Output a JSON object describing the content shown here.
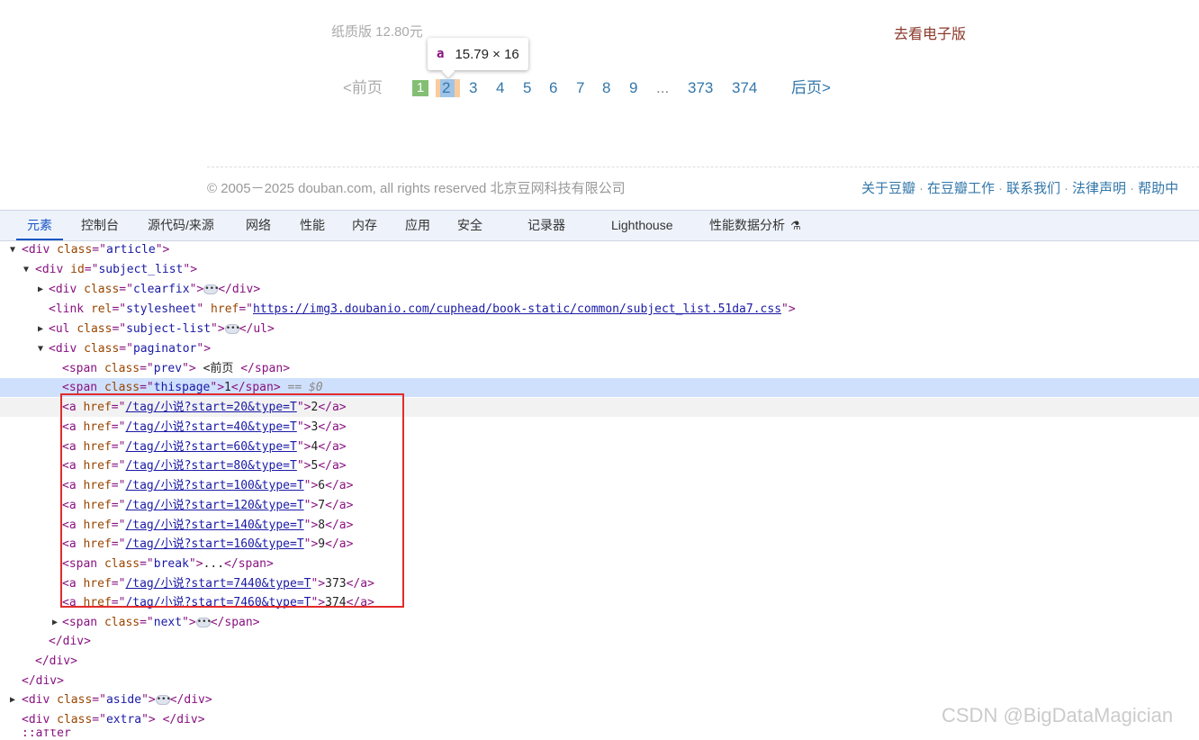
{
  "webpage": {
    "paper_price": "纸质版 12.80元",
    "ebook_link": "去看电子版",
    "tooltip": {
      "tag": "a",
      "size": "15.79 × 16"
    },
    "pager": {
      "prev": "<前页",
      "current": "1",
      "pages": [
        "2",
        "3",
        "4",
        "5",
        "6",
        "7",
        "8",
        "9"
      ],
      "break": "...",
      "last_pages": [
        "373",
        "374"
      ],
      "next": "后页>"
    },
    "footer": {
      "copyright": "© 2005－2025 douban.com, all rights reserved 北京豆网科技有限公司",
      "links": [
        "关于豆瓣",
        "在豆瓣工作",
        "联系我们",
        "法律声明",
        "帮助中"
      ]
    }
  },
  "devtools": {
    "tabs": [
      "元素",
      "控制台",
      "源代码/来源",
      "网络",
      "性能",
      "内存",
      "应用",
      "安全",
      "记录器",
      "Lighthouse",
      "性能数据分析"
    ],
    "active_tab": "元素",
    "nodes": {
      "article": {
        "tag": "div",
        "attr": "class",
        "val": "article"
      },
      "subject_list": {
        "tag": "div",
        "attr": "id",
        "val": "subject_list"
      },
      "clearfix": {
        "tag": "div",
        "attr": "class",
        "val": "clearfix"
      },
      "link": {
        "tag": "link",
        "rel": "stylesheet",
        "href": "https://img3.doubanio.com/cuphead/book-static/common/subject_list.51da7.css"
      },
      "ul": {
        "tag": "ul",
        "attr": "class",
        "val": "subject-list"
      },
      "paginator": {
        "tag": "div",
        "attr": "class",
        "val": "paginator"
      },
      "prev": {
        "tag": "span",
        "attr": "class",
        "val": "prev",
        "text": "<前页 "
      },
      "thispage": {
        "tag": "span",
        "attr": "class",
        "val": "thispage",
        "text": "1",
        "marker": "== $0"
      },
      "anchors": [
        {
          "href": "/tag/小说?start=20&type=T",
          "text": "2"
        },
        {
          "href": "/tag/小说?start=40&type=T",
          "text": "3"
        },
        {
          "href": "/tag/小说?start=60&type=T",
          "text": "4"
        },
        {
          "href": "/tag/小说?start=80&type=T",
          "text": "5"
        },
        {
          "href": "/tag/小说?start=100&type=T",
          "text": "6"
        },
        {
          "href": "/tag/小说?start=120&type=T",
          "text": "7"
        },
        {
          "href": "/tag/小说?start=140&type=T",
          "text": "8"
        },
        {
          "href": "/tag/小说?start=160&type=T",
          "text": "9"
        }
      ],
      "break": {
        "tag": "span",
        "attr": "class",
        "val": "break",
        "text": "..."
      },
      "anchors_last": [
        {
          "href": "/tag/小说?start=7440&type=T",
          "text": "373"
        },
        {
          "href": "/tag/小说?start=7460&type=T",
          "text": "374"
        }
      ],
      "next": {
        "tag": "span",
        "attr": "class",
        "val": "next"
      },
      "aside": {
        "tag": "div",
        "attr": "class",
        "val": "aside"
      },
      "extra": {
        "tag": "div",
        "attr": "class",
        "val": "extra"
      },
      "after": "::after"
    }
  },
  "watermark": "CSDN @BigDataMagician"
}
